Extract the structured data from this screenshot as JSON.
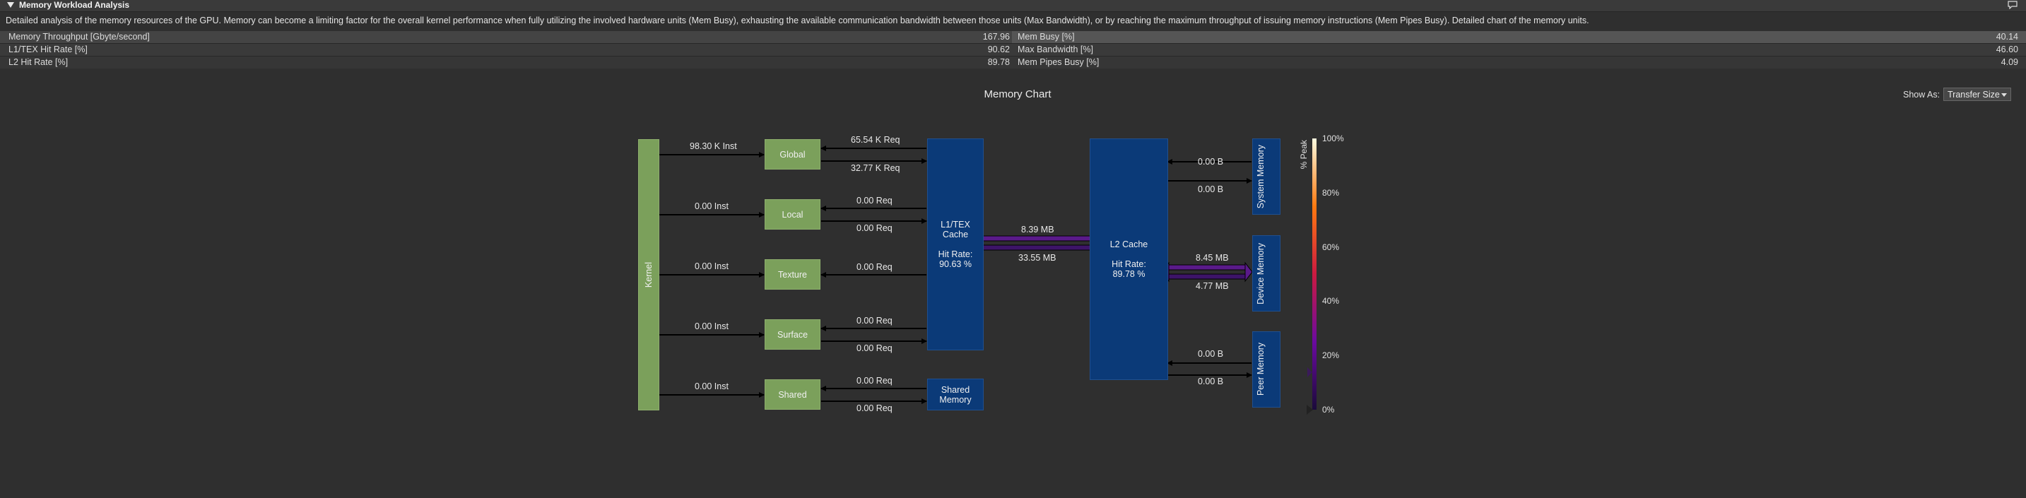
{
  "section": {
    "title": "Memory Workload Analysis",
    "description": "Detailed analysis of the memory resources of the GPU. Memory can become a limiting factor for the overall kernel performance when fully utilizing the involved hardware units (Mem Busy), exhausting the available communication bandwidth between those units (Max Bandwidth), or by reaching the maximum throughput of issuing memory instructions (Mem Pipes Busy). Detailed chart of the memory units."
  },
  "metrics": [
    {
      "name": "Memory Throughput [Gbyte/second]",
      "value": "167.96",
      "name2": "Mem Busy [%]",
      "value2": "40.14"
    },
    {
      "name": "L1/TEX Hit Rate [%]",
      "value": "90.62",
      "name2": "Max Bandwidth [%]",
      "value2": "46.60"
    },
    {
      "name": "L2 Hit Rate [%]",
      "value": "89.78",
      "name2": "Mem Pipes Busy [%]",
      "value2": "4.09"
    }
  ],
  "chart": {
    "title": "Memory Chart",
    "show_as_label": "Show As:",
    "show_as_value": "Transfer Size",
    "kernel": "Kernel",
    "spaces": [
      "Global",
      "Local",
      "Texture",
      "Surface",
      "Shared"
    ],
    "inst_labels": [
      "98.30 K Inst",
      "0.00 Inst",
      "0.00 Inst",
      "0.00 Inst",
      "0.00 Inst"
    ],
    "req_top": [
      "65.54 K Req",
      "0.00 Req",
      "0.00 Req",
      "0.00 Req",
      "0.00 Req"
    ],
    "req_bottom": [
      "32.77 K Req",
      "0.00 Req",
      "",
      "0.00 Req",
      "0.00 Req"
    ],
    "l1": {
      "name_line1": "L1/TEX",
      "name_line2": "Cache",
      "hit_label": "Hit Rate:",
      "hit_value": "90.63 %"
    },
    "shared_mem": {
      "line1": "Shared",
      "line2": "Memory"
    },
    "l1_l2": {
      "top": "8.39 MB",
      "bottom": "33.55 MB"
    },
    "l2": {
      "name": "L2 Cache",
      "hit_label": "Hit Rate:",
      "hit_value": "89.78 %"
    },
    "system": {
      "name": "System Memory",
      "top": "0.00 B",
      "bottom": "0.00 B"
    },
    "device": {
      "name": "Device Memory",
      "top": "8.45 MB",
      "bottom": "4.77 MB"
    },
    "peer": {
      "name": "Peer Memory",
      "top": "0.00 B",
      "bottom": "0.00 B"
    },
    "colorbar": {
      "title": "% Peak",
      "ticks": [
        "100%",
        "80%",
        "60%",
        "40%",
        "20%",
        "0%"
      ]
    },
    "colors": {
      "green": "#7ba05b",
      "blue": "#0b3a78",
      "purple": "#5a1a8a",
      "bg": "#2f2f2f"
    }
  }
}
